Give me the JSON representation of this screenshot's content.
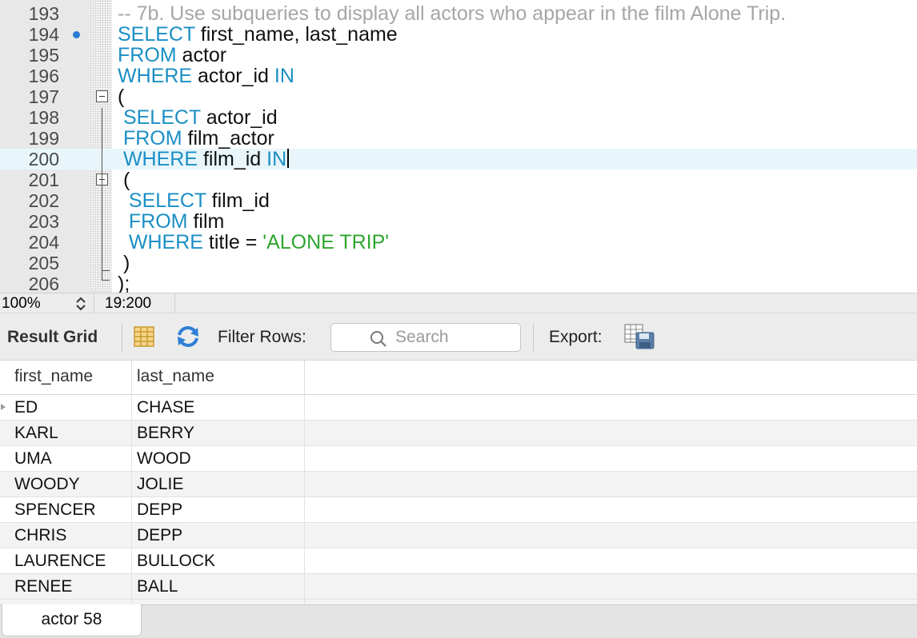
{
  "editor": {
    "lines": [
      {
        "num": "193",
        "tokens": [
          {
            "t": "-- 7b. Use subqueries to display all actors who appear in the film Alone Trip.",
            "c": "cm"
          }
        ]
      },
      {
        "num": "194",
        "breakpoint": true,
        "tokens": [
          {
            "t": "SELECT",
            "c": "kw"
          },
          {
            "t": " first_name, last_name",
            "c": "id"
          }
        ]
      },
      {
        "num": "195",
        "tokens": [
          {
            "t": "FROM",
            "c": "kw"
          },
          {
            "t": " actor",
            "c": "id"
          }
        ]
      },
      {
        "num": "196",
        "tokens": [
          {
            "t": "WHERE",
            "c": "kw"
          },
          {
            "t": " actor_id ",
            "c": "id"
          },
          {
            "t": "IN",
            "c": "kw"
          }
        ]
      },
      {
        "num": "197",
        "fold": true,
        "tokens": [
          {
            "t": "(",
            "c": "id"
          }
        ]
      },
      {
        "num": "198",
        "tokens": [
          {
            "t": " SELECT",
            "c": "kw"
          },
          {
            "t": " actor_id",
            "c": "id"
          }
        ]
      },
      {
        "num": "199",
        "tokens": [
          {
            "t": " FROM",
            "c": "kw"
          },
          {
            "t": " film_actor",
            "c": "id"
          }
        ]
      },
      {
        "num": "200",
        "current": true,
        "tokens": [
          {
            "t": " WHERE",
            "c": "kw"
          },
          {
            "t": " film_id ",
            "c": "id"
          },
          {
            "t": "IN",
            "c": "kw"
          }
        ]
      },
      {
        "num": "201",
        "fold": true,
        "tokens": [
          {
            "t": " (",
            "c": "id"
          }
        ]
      },
      {
        "num": "202",
        "tokens": [
          {
            "t": "  SELECT",
            "c": "kw"
          },
          {
            "t": " film_id",
            "c": "id"
          }
        ]
      },
      {
        "num": "203",
        "tokens": [
          {
            "t": "  FROM",
            "c": "kw"
          },
          {
            "t": " film",
            "c": "id"
          }
        ]
      },
      {
        "num": "204",
        "tokens": [
          {
            "t": "  WHERE",
            "c": "kw"
          },
          {
            "t": " title = ",
            "c": "id"
          },
          {
            "t": "'ALONE TRIP'",
            "c": "str"
          }
        ]
      },
      {
        "num": "205",
        "tokens": [
          {
            "t": " )",
            "c": "id"
          }
        ]
      },
      {
        "num": "206",
        "tokens": [
          {
            "t": ");",
            "c": "id"
          }
        ]
      }
    ]
  },
  "status": {
    "zoom": "100%",
    "cursor_position": "19:200"
  },
  "toolbar": {
    "result_grid_label": "Result Grid",
    "filter_rows_label": "Filter Rows:",
    "search_placeholder": "Search",
    "export_label": "Export:"
  },
  "grid": {
    "columns": [
      "first_name",
      "last_name"
    ],
    "rows": [
      [
        "ED",
        "CHASE"
      ],
      [
        "KARL",
        "BERRY"
      ],
      [
        "UMA",
        "WOOD"
      ],
      [
        "WOODY",
        "JOLIE"
      ],
      [
        "SPENCER",
        "DEPP"
      ],
      [
        "CHRIS",
        "DEPP"
      ],
      [
        "LAURENCE",
        "BULLOCK"
      ],
      [
        "RENEE",
        "BALL"
      ]
    ]
  },
  "tabs": {
    "result_tab_label": "actor 58"
  },
  "colors": {
    "keyword": "#1a8fc4",
    "string": "#2fa52f",
    "comment": "#a6a6a6",
    "current_line": "#e8f6fc",
    "breakpoint": "#2a7bd4"
  }
}
